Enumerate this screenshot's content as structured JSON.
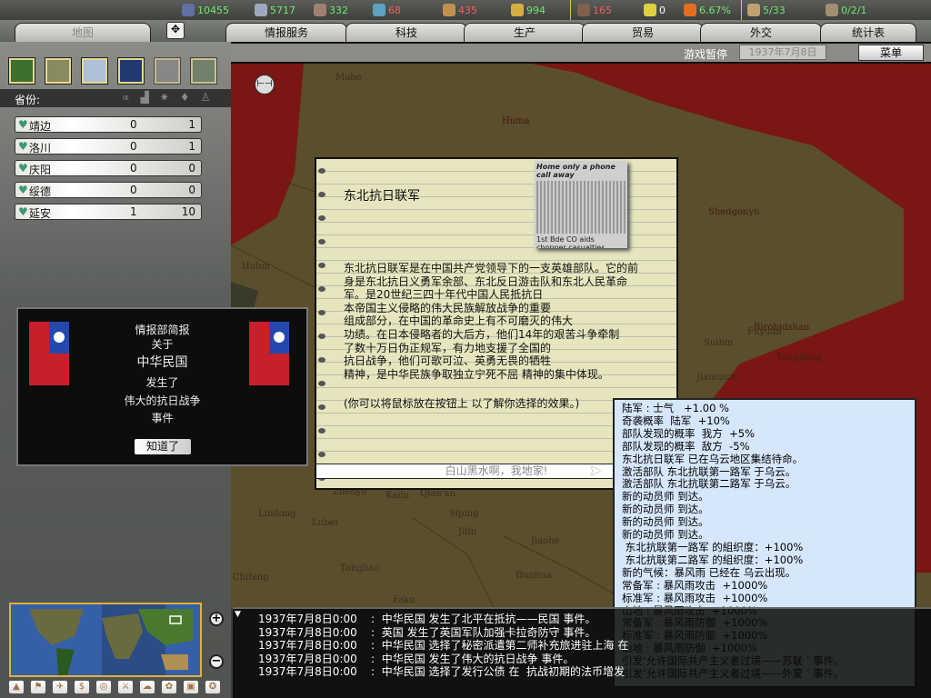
{
  "resources": [
    {
      "name": "energy",
      "value": "10455",
      "color": "#6fe86f"
    },
    {
      "name": "metal",
      "value": "5717",
      "color": "#6fe86f"
    },
    {
      "name": "rare-materials",
      "value": "332",
      "color": "#6fe86f"
    },
    {
      "name": "oil",
      "value": "68",
      "color": "#f06060"
    },
    {
      "name": "supplies",
      "value": "435",
      "color": "#f06060"
    },
    {
      "name": "money",
      "value": "994",
      "color": "#6fe86f"
    },
    {
      "name": "manpower",
      "value": "165",
      "color": "#f06060"
    },
    {
      "name": "nuclear",
      "value": "0",
      "color": "#ffffff"
    },
    {
      "name": "dissent",
      "value": "6.67%",
      "color": "#6fe86f"
    },
    {
      "name": "transport",
      "value": "5/33",
      "color": "#6fe86f"
    },
    {
      "name": "convoys",
      "value": "0/2/1",
      "color": "#6fe86f"
    }
  ],
  "tabs": {
    "map": "地图",
    "intel": "情报服务",
    "tech": "科技",
    "production": "生产",
    "trade": "贸易",
    "diplomacy": "外交",
    "stats": "统计表"
  },
  "status": {
    "paused": "游戏暂停",
    "date": "1937年7月8日0:00",
    "menu": "菜单"
  },
  "provinces": {
    "header": "省份:",
    "rows": [
      {
        "name": "靖边",
        "a": "0",
        "b": "1"
      },
      {
        "name": "洛川",
        "a": "0",
        "b": "1"
      },
      {
        "name": "庆阳",
        "a": "0",
        "b": "0"
      },
      {
        "name": "绥德",
        "a": "0",
        "b": "0"
      },
      {
        "name": "延安",
        "a": "1",
        "b": "10"
      }
    ]
  },
  "intel": {
    "l1": "情报部简报",
    "l2": "关于",
    "country": "中华民国",
    "l3": "发生了",
    "event": "伟大的抗日战争",
    "l4": "事件",
    "ok": "知道了"
  },
  "event": {
    "title": "东北抗日联军",
    "body": [
      "东北抗日联军是在中国共产党领导下的一支英雄部队。它的前",
      "身是东北抗日义勇军余部、东北反日游击队和东北人民革命",
      "军。是20世纪三四十年代中国人民抵抗日",
      "本帝国主义侵略的伟大民族解放战争的重要",
      "组成部分，在中国的革命史上有不可磨灭的伟大",
      "功绩。在日本侵略者的大后方，他们14年的艰苦斗争牵制",
      "了数十万日伪正规军，有力地支援了全国的",
      "抗日战争，他们可歌可泣、英勇无畏的牺牲",
      "精神，是中华民族争取独立宁死不屈 精神的集中体现。"
    ],
    "hint": "(你可以将鼠标放在按钮上 以了解你选择的效果。)",
    "option": "白山黑水啊，我地家!",
    "newspaper_headline": "Home only a phone call away",
    "newspaper_caption": "1st Bde CO aids chopper casualties"
  },
  "tooltip": [
    "陆军 : 士气   +1.00 %",
    "奇袭概率  陆军  +10%",
    "部队发现的概率  我方  +5%",
    "部队发现的概率  敌方  -5%",
    "东北抗日联军 已在乌云地区集结待命。",
    "激活部队 东北抗联第一路军 于乌云。",
    "激活部队 东北抗联第二路军 于乌云。",
    "新的动员师 到达。",
    "新的动员师 到达。",
    "新的动员师 到达。",
    "新的动员师 到达。",
    " 东北抗联第一路军 的組织度：+100%",
    " 东北抗联第二路军 的組织度：+100%",
    "新的气候：暴风雨 已经在 乌云出现。",
    "常备军 : 暴风雨攻击  +1000%",
    "标准军 : 暴风雨攻击  +1000%",
    "山地 : 暴风雨攻击  +1000%",
    "常备军 : 暴风雨防御  +1000%",
    "标准军 : 暴风雨防御  +1000%",
    "山地 : 暴风雨防御  +1000%",
    "引发‘允许国际共产主义者过境——苏联 ’ 事件。",
    "引发‘允许国际共产主义者过境——外蒙 ’ 事件。"
  ],
  "log": [
    {
      "time": "1937年7月8日0:00",
      "text": "中华民国 发生了北平在抵抗——民国 事件。"
    },
    {
      "time": "1937年7月8日0:00",
      "text": "英国 发生了英国军队加强卡拉奇防守 事件。"
    },
    {
      "time": "1937年7月8日0:00",
      "text": "中华民国 选择了秘密派遣第二师补充旅进驻上海 在"
    },
    {
      "time": "1937年7月8日0:00",
      "text": "中华民国 发生了伟大的抗日战争 事件。"
    },
    {
      "time": "1937年7月8日0:00",
      "text": "中华民国 选择了发行公债 在  抗战初期的法币增发"
    }
  ],
  "map_labels": [
    "Mohe",
    "Huma",
    "Hulun",
    "Shedgonyn",
    "Birobidshan",
    "Fuyuan",
    "Suibin",
    "Jiamusze",
    "Tongjiang",
    "Qian'an",
    "Lindong",
    "Zhenyu",
    "Lubei",
    "Kailu",
    "Siping",
    "Jilin",
    "Jiaohe",
    "Tongliao",
    "Chifeng",
    "Dunhua",
    "Faku"
  ]
}
